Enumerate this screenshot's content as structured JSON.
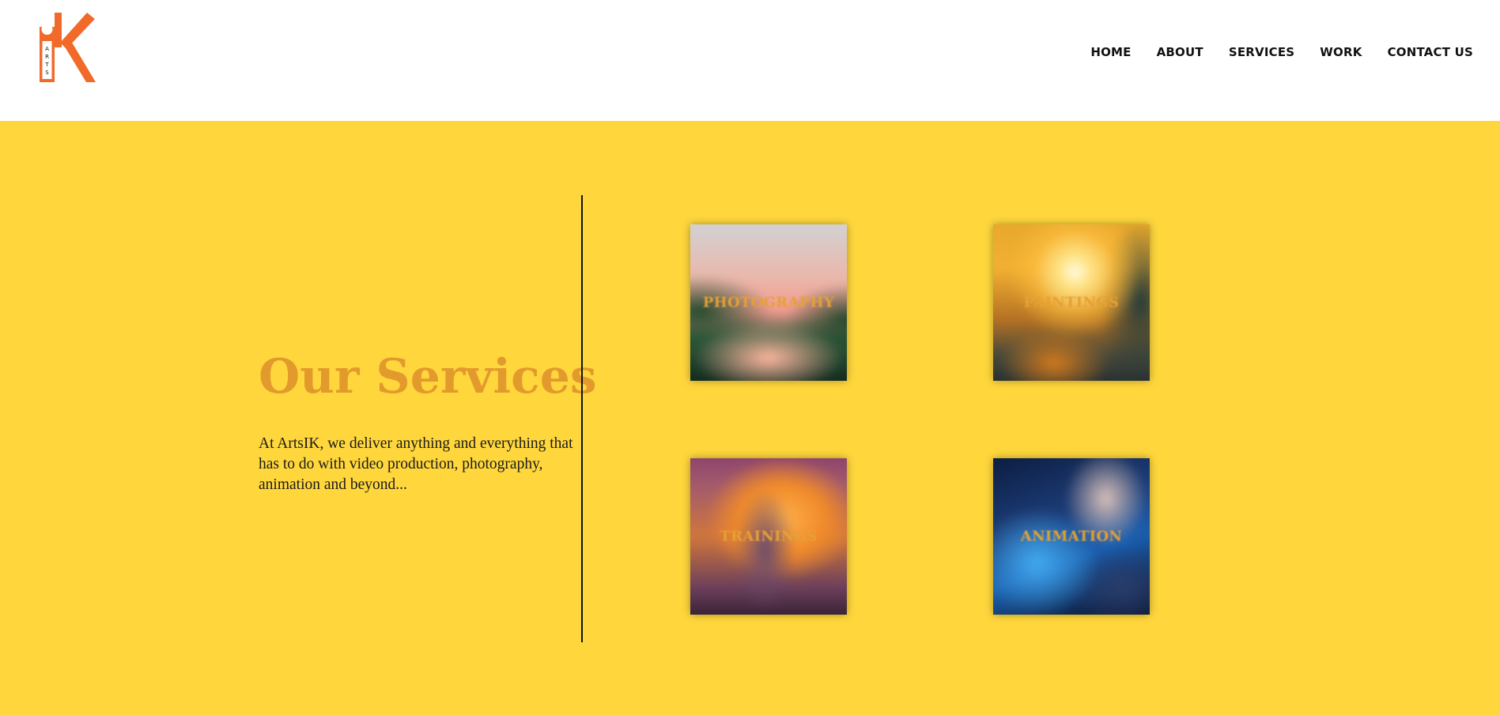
{
  "brand": {
    "logo_icon": "arts-ik-logo",
    "logo_text": "ARTS",
    "logo_color": "#f26a2a"
  },
  "nav": {
    "items": [
      {
        "label": "HOME"
      },
      {
        "label": "ABOUT"
      },
      {
        "label": "SERVICES"
      },
      {
        "label": "WORK"
      },
      {
        "label": "CONTACT US"
      }
    ]
  },
  "services": {
    "title": "Our Services",
    "description": "At ArtsIK, we deliver anything and everything that has to do with video production, photography, animation and beyond...",
    "cards": [
      {
        "label": "PHOTOGRAPHY"
      },
      {
        "label": "PAINTINGS"
      },
      {
        "label": "TRAININGS"
      },
      {
        "label": "ANIMATION"
      }
    ]
  },
  "colors": {
    "section_background": "#ffd73c",
    "title_color": "#e39a2c",
    "header_background": "#ffffff"
  }
}
